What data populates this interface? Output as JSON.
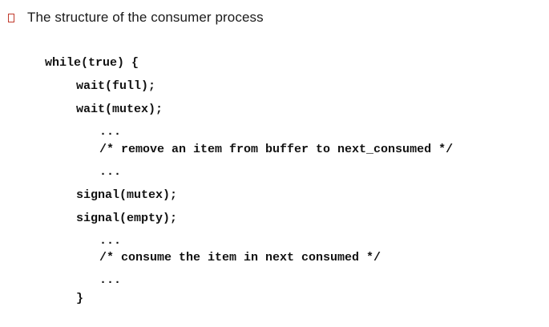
{
  "bullet": {
    "icon": "hollow-square-bullet-icon",
    "color": "#c0392b",
    "text": "The structure of the consumer process"
  },
  "code": {
    "lines": [
      "while(true) {",
      "wait(full);",
      "wait(mutex);",
      "...",
      "/* remove an item from buffer to next_consumed */",
      "...",
      "signal(mutex);",
      "signal(empty);",
      "...",
      "/* consume the item in next consumed */",
      "...",
      "}"
    ]
  }
}
